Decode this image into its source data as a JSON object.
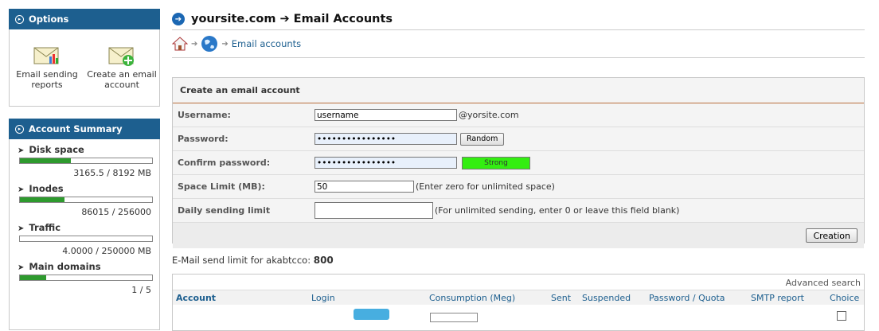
{
  "sidebar": {
    "options_title": "Options",
    "options": [
      {
        "label": "Email sending reports",
        "icon": "email-report-icon"
      },
      {
        "label": "Create an email account",
        "icon": "email-add-icon"
      }
    ],
    "summary_title": "Account Summary",
    "summary": [
      {
        "title": "Disk space",
        "value": "3165.5 / 8192 MB",
        "fill": 0.386
      },
      {
        "title": "Inodes",
        "value": "86015 / 256000",
        "fill": 0.336
      },
      {
        "title": "Traffic",
        "value": "4.0000 / 250000 MB",
        "fill": 0.0
      },
      {
        "title": "Main domains",
        "value": "1 / 5",
        "fill": 0.2
      }
    ]
  },
  "header": {
    "title": "yoursite.com ➔ Email Accounts",
    "breadcrumb_link": "Email accounts"
  },
  "form": {
    "title": "Create an email account",
    "username_label": "Username:",
    "username_value": "username",
    "domain_suffix": "@yorsite.com",
    "password_label": "Password:",
    "password_value": "••••••••••••••••",
    "random_button": "Random",
    "confirm_label": "Confirm password:",
    "confirm_value": "••••••••••••••••",
    "strength": "Strong",
    "space_label": "Space Limit (MB):",
    "space_value": "50",
    "space_hint": "(Enter zero for unlimited space)",
    "daily_label": "Daily sending limit",
    "daily_value": "",
    "daily_hint": "(For unlimited sending, enter 0 or leave this field blank)",
    "create_button": "Creation",
    "colors": {
      "strength": "#33ee11",
      "accent": "#1d5f8f",
      "divider": "#b86e3e"
    }
  },
  "limit": {
    "text": "E-Mail send limit for akabtcco:",
    "value": "800"
  },
  "accounts": {
    "advanced_search": "Advanced search",
    "columns": [
      "Account",
      "Login",
      "Consumption (Meg)",
      "Sent",
      "Suspended",
      "Password / Quota",
      "SMTP report",
      "Choice"
    ]
  }
}
